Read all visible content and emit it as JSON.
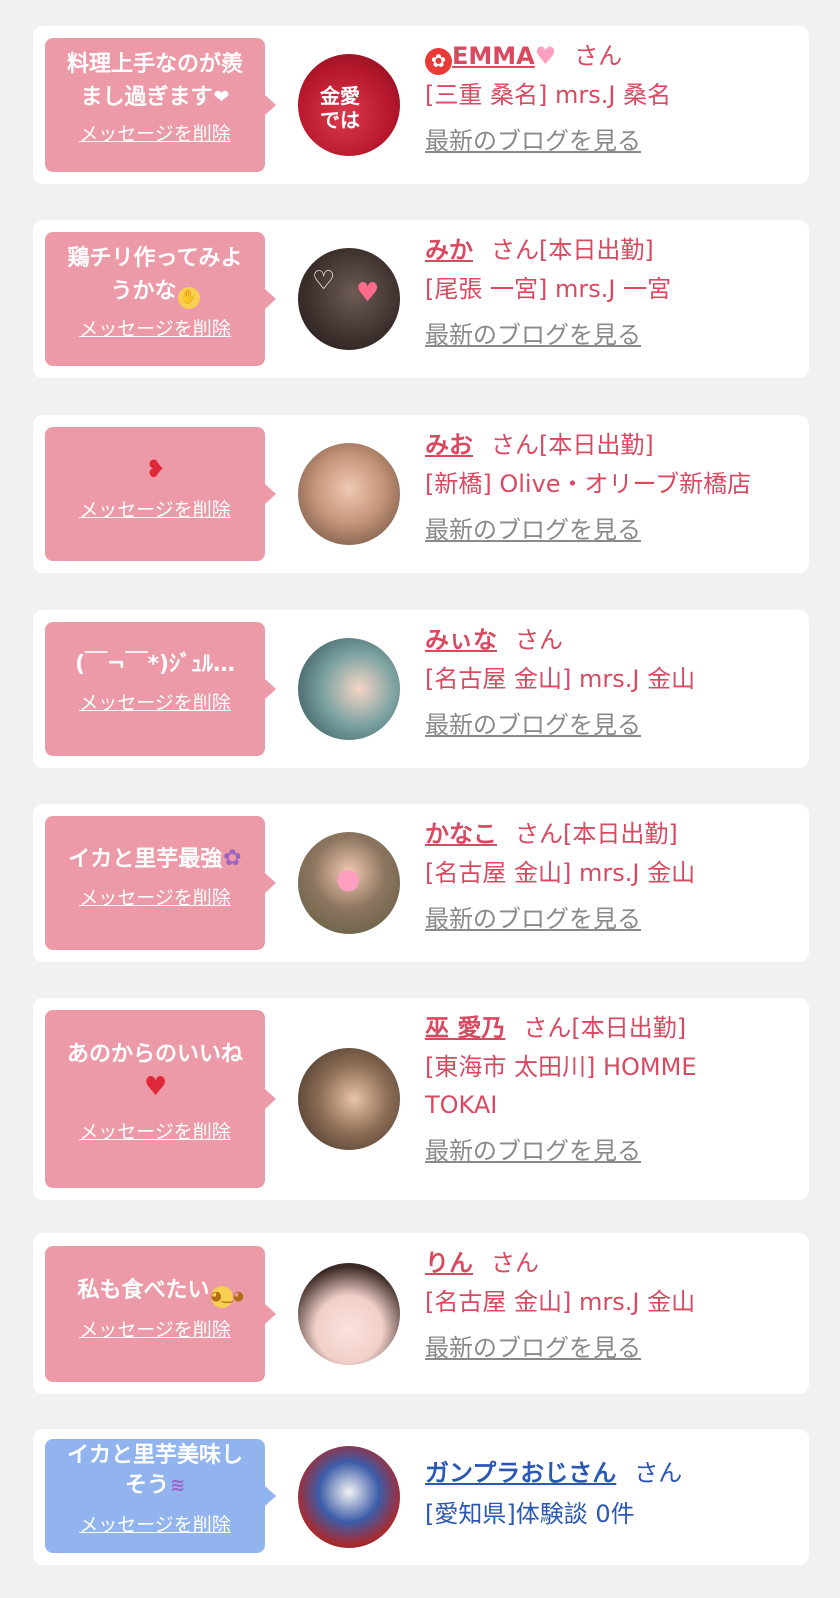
{
  "delete_label": "メッセージを削除",
  "blog_label": "最新のブログを見る",
  "colors": {
    "background": "#f1f1f1",
    "card": "#ffffff",
    "pink_bubble": "#ec9aa7",
    "blue_bubble": "#91b4ee",
    "pink_text": "#d94a61",
    "blue_text": "#2b57b5",
    "gray_link": "#8a8a8a"
  },
  "entries": [
    {
      "message": "料理上手なのが羨\nまし過ぎます",
      "message_emoji": "white-heart",
      "name": "EMMA",
      "name_prefix_icon": "rose-icon",
      "name_suffix_icon": "pink-heart-icon",
      "suffix": "さん",
      "shop": "[三重 桑名] mrs.J 桑名",
      "avatar_text": "金愛\nでは",
      "has_blog": true
    },
    {
      "message": "鶏チリ作ってみよ\nうかな",
      "message_emoji": "hand-over-mouth-face",
      "name": "みか",
      "suffix": "さん[本日出勤]",
      "shop": "[尾張 一宮] mrs.J 一宮",
      "has_blog": true
    },
    {
      "message": "",
      "message_emoji": "heart-with-arrow",
      "name": "みお",
      "suffix": "さん[本日出勤]",
      "shop": "[新橋] Olive・オリーブ新橋店",
      "has_blog": true
    },
    {
      "message": "(￣¬￣*)ｼﾞｭﾙ…",
      "name": "みぃな",
      "suffix": "さん",
      "shop": "[名古屋 金山] mrs.J 金山",
      "has_blog": true
    },
    {
      "message": "イカと里芋最強",
      "message_emoji": "octopus",
      "name": "かなこ",
      "suffix": "さん[本日出勤]",
      "shop": "[名古屋 金山] mrs.J 金山",
      "has_blog": true
    },
    {
      "message": "あのからのいいね",
      "message_emoji": "red-heart",
      "name": "巫 愛乃",
      "suffix": "さん[本日出勤]",
      "shop": "[東海市 太田川] HOMME\nTOKAI",
      "has_blog": true
    },
    {
      "message": "私も食べたい",
      "message_emoji": "pleading-face",
      "name": "りん",
      "suffix": "さん",
      "shop": "[名古屋 金山] mrs.J 金山",
      "has_blog": true
    },
    {
      "message": "イカと里芋美味し\nそう",
      "message_emoji": "drooling-face",
      "name": "ガンプラおじさん",
      "suffix": "さん",
      "shop": "[愛知県]体験談 0件",
      "has_blog": false
    }
  ]
}
